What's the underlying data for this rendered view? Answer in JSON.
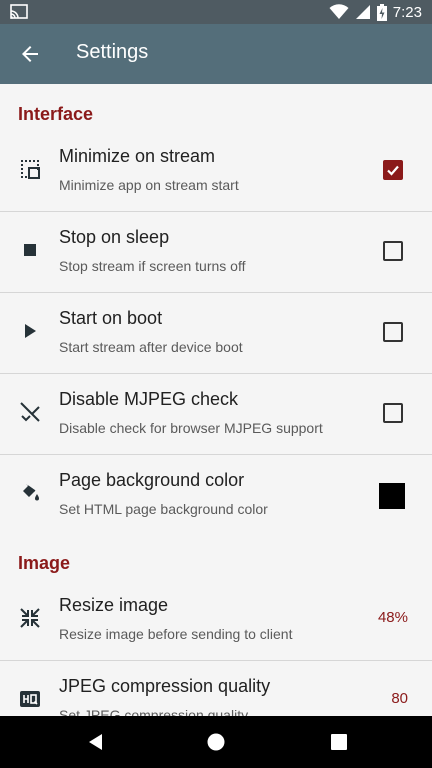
{
  "status_bar": {
    "time": "7:23",
    "left_icon": "cast-icon",
    "right_icons": [
      "wifi-icon",
      "signal-icon",
      "battery-icon"
    ]
  },
  "app_bar": {
    "title": "Settings",
    "back_icon": "arrow-back-icon"
  },
  "sections": {
    "interface": {
      "title": "Interface",
      "items": [
        {
          "title": "Minimize on stream",
          "subtitle": "Minimize app on stream start",
          "icon": "minimize-selection-icon",
          "control": "checkbox",
          "checked": true
        },
        {
          "title": "Stop on sleep",
          "subtitle": "Stop stream if screen turns off",
          "icon": "stop-icon",
          "control": "checkbox",
          "checked": false
        },
        {
          "title": "Start on boot",
          "subtitle": "Start stream after device boot",
          "icon": "play-icon",
          "control": "checkbox",
          "checked": false
        },
        {
          "title": "Disable MJPEG check",
          "subtitle": "Disable check for browser MJPEG support",
          "icon": "disable-check-icon",
          "control": "checkbox",
          "checked": false
        },
        {
          "title": "Page background color",
          "subtitle": "Set HTML page background color",
          "icon": "paint-bucket-icon",
          "control": "color",
          "color": "#000000"
        }
      ]
    },
    "image": {
      "title": "Image",
      "items": [
        {
          "title": "Resize image",
          "subtitle": "Resize image before sending to client",
          "icon": "resize-icon",
          "control": "value",
          "value": "48%"
        },
        {
          "title": "JPEG compression quality",
          "subtitle": "Set JPEG compression quality",
          "icon": "hq-icon",
          "control": "value",
          "value": "80"
        }
      ]
    }
  },
  "nav_bar": {
    "icons": [
      "back-triangle-icon",
      "home-circle-icon",
      "recents-square-icon"
    ]
  },
  "colors": {
    "accent": "#8b1a1a",
    "app_bar": "#546e7a",
    "status_bar": "#4f5b62"
  }
}
